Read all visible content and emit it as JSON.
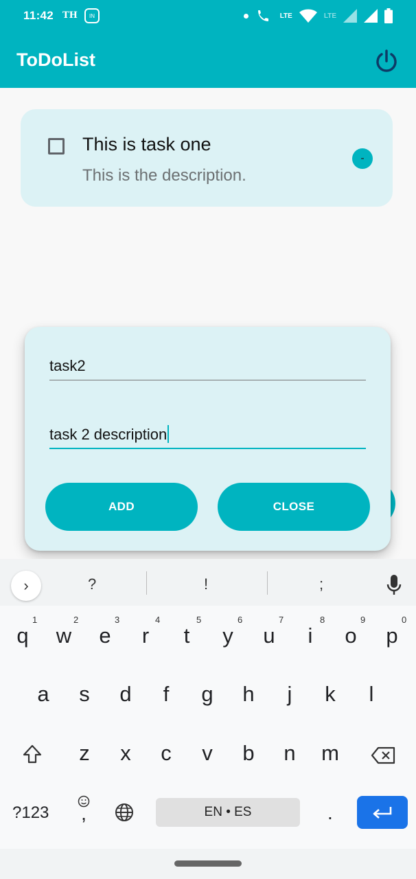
{
  "status_bar": {
    "time": "11:42",
    "carrier_label": "TH",
    "badge_text": "IN",
    "network_label_1": "LTE",
    "network_label_2": "LTE"
  },
  "app_bar": {
    "title": "ToDoList",
    "power_icon": "power-icon"
  },
  "tasks": [
    {
      "title": "This is task one",
      "description": "This is the description.",
      "checked": false,
      "remove_label": "-"
    }
  ],
  "dialog": {
    "title_field_value": "task2",
    "description_field_value": "task 2 description",
    "add_label": "ADD",
    "close_label": "CLOSE"
  },
  "keyboard": {
    "suggestions": [
      "?",
      "!",
      ";"
    ],
    "row1": [
      "q",
      "w",
      "e",
      "r",
      "t",
      "y",
      "u",
      "i",
      "o",
      "p"
    ],
    "row1_numbers": [
      "1",
      "2",
      "3",
      "4",
      "5",
      "6",
      "7",
      "8",
      "9",
      "0"
    ],
    "row2": [
      "a",
      "s",
      "d",
      "f",
      "g",
      "h",
      "j",
      "k",
      "l"
    ],
    "row3": [
      "z",
      "x",
      "c",
      "v",
      "b",
      "n",
      "m"
    ],
    "symbols_label": "?123",
    "comma_label": ",",
    "space_label": "EN • ES",
    "period_label": "."
  },
  "colors": {
    "accent": "#00b4c0",
    "card_bg": "#dcf2f5",
    "enter_key": "#1a73e8"
  }
}
